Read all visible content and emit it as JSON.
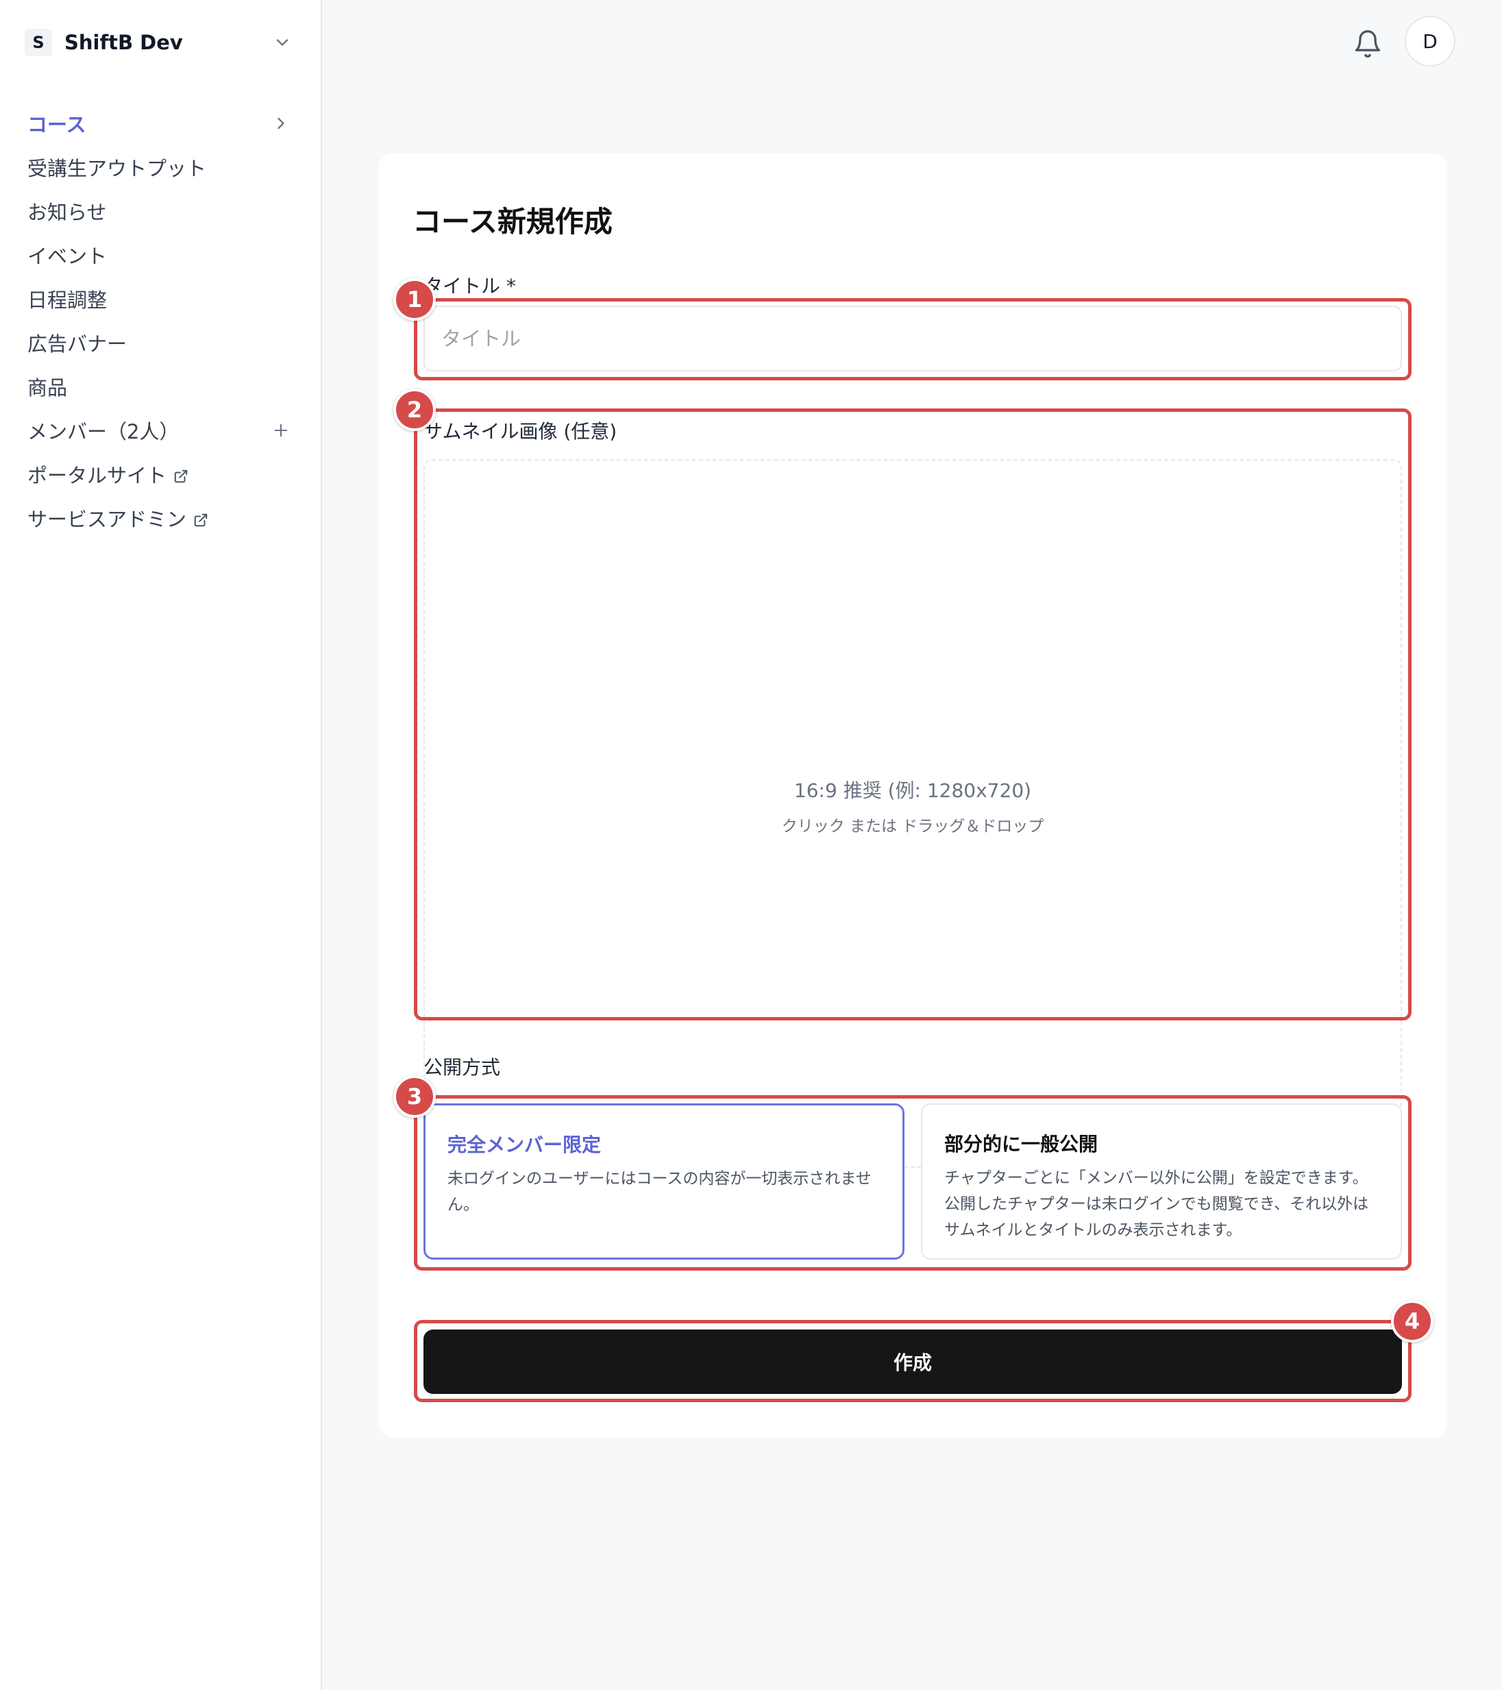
{
  "workspace": {
    "initial": "S",
    "name": "ShiftB Dev"
  },
  "sidebar": {
    "items": [
      {
        "label": "コース"
      },
      {
        "label": "受講生アウトプット"
      },
      {
        "label": "お知らせ"
      },
      {
        "label": "イベント"
      },
      {
        "label": "日程調整"
      },
      {
        "label": "広告バナー"
      },
      {
        "label": "商品"
      },
      {
        "label": "メンバー（2人）"
      },
      {
        "label": "ポータルサイト"
      },
      {
        "label": "サービスアドミン"
      }
    ]
  },
  "header": {
    "avatar_initial": "D"
  },
  "form": {
    "page_title": "コース新規作成",
    "title_label": "タイトル *",
    "title_placeholder": "タイトル",
    "thumbnail_label": "サムネイル画像 (任意)",
    "thumbnail_hint_main": "16:9 推奨 (例: 1280x720)",
    "thumbnail_hint_sub": "クリック または ドラッグ＆ドロップ",
    "visibility_label": "公開方式",
    "options": [
      {
        "title": "完全メンバー限定",
        "description": "未ログインのユーザーにはコースの内容が一切表示されません。",
        "selected": true
      },
      {
        "title": "部分的に一般公開",
        "description": "チャプターごとに「メンバー以外に公開」を設定できます。公開したチャプターは未ログインでも閲覧でき、それ以外はサムネイルとタイトルのみ表示されます。",
        "selected": false
      }
    ],
    "submit_label": "作成"
  },
  "annotations": {
    "badges": [
      "1",
      "2",
      "3",
      "4"
    ]
  },
  "colors": {
    "accent": "#5b63d3",
    "annotation": "#d64a4a",
    "button": "#161616"
  }
}
